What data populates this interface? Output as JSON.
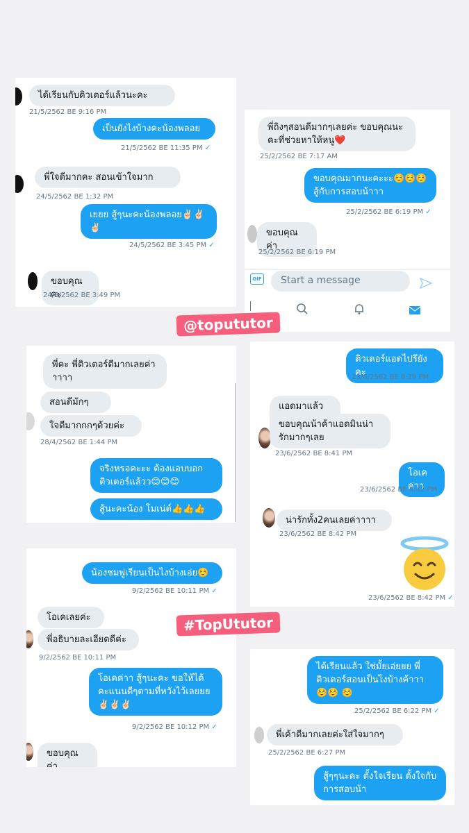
{
  "watermarks": {
    "handle": "@topututor",
    "hashtag": "#TopUtutor"
  },
  "chat_a": {
    "m1": "ได้เรียนกับติวเตอร์แล้วนะคะ",
    "t1": "21/5/2562 BE 9:16 PM",
    "m2": "เป็นยังไงบ้างคะน้องพลอย",
    "t2": "21/5/2562 BE 11:35 PM",
    "m3": "พี่ใจดีมากคะ สอนเข้าใจมาก",
    "t3": "24/5/2562 BE 1:32 PM",
    "m4": "เยยย สู้ๆนะคะน้องพลอย✌🏻✌🏻 ✌🏻",
    "t4": "24/5/2562 BE 3:45 PM",
    "m5": "ขอบคุณคะ",
    "t5": "24/5/2562 BE 3:49 PM"
  },
  "chat_b": {
    "m1": "พี่ถิงๆสอนดีมากๆเลยค่ะ ขอบคุณนะคะที่ช่วยหาให้หนู❤️",
    "t1": "25/2/2562 BE 7:17 AM",
    "m2": "ขอบคุณมากนะคะะะ☺️☺️☺️ สู้กับการสอบน้าาา",
    "t2": "25/2/2562 BE 6:19 PM",
    "m3": "ขอบคุณค่า",
    "t3": "25/2/2562 BE 6:19 PM",
    "composer_placeholder": "Start a message",
    "gif_label": "GIF"
  },
  "chat_c": {
    "m1": "พี่คะ พี่ติวเตอร์ดีมากเลยค่า าาาา",
    "m2": "สอนดีมักๆ",
    "m3": "ใจดีมากกกๆด้วยค่ะ",
    "t3": "28/4/2562 BE 1:44 PM",
    "m4": "จริงหรอคะะะ ต้องแอบบอกติวเตอร์แล้วว😊😊😊",
    "m5": "สู้นะคะน้อง โมเน่ต์👍👍👍"
  },
  "chat_d": {
    "m1": "ติวเตอร์แอดไปรึยังคะ",
    "t1": "23/6/2562 BE 8:39 PM",
    "m2": "แอดมาแล้วค้าาา",
    "m3": "ขอบคุณน้าค้าแอดมินน่ารักมากๆเลย",
    "t3": "23/6/2562 BE 8:41 PM",
    "m4": "โอเคค่าา",
    "t4": "23/6/2562 BE 8:42 PM",
    "m5": "น่ารักทั้ง2คนเลยค่าาาา",
    "t5": "23/6/2562 BE 8:42 PM",
    "t6": "23/6/2562 BE 8:42 PM"
  },
  "chat_e": {
    "m1": "น้องชมพู่เรียนเป็นไงบ้างเอ่ย☺️",
    "t1": "9/2/2562 BE 10:11 PM",
    "m2": "โอเคเลยค่ะ",
    "m3": "พี่อธิบายละเอียดดีค่ะ",
    "t3": "9/2/2562 BE 10:11 PM",
    "m4": "โอเคค่าา สู้ๆนะคะ ขอให้ได้คะแนนดีๆตามที่หวังไว้เลยยย ✌🏻✌🏻✌🏻",
    "t4": "9/2/2562 BE 10:12 PM",
    "m5": "ขอบคุณค่า"
  },
  "chat_f": {
    "m1": "ได้เรียนแล้ว ใช่มั้ยเอ่ยยย พี่ติวเตอร์สอนเป็นไงบ้างค้าาา☺️☺️ ☺️",
    "t1": "25/2/2562 BE 6:22 PM",
    "m2": "พี่เค้าดีมากเลยค่ะใส่ใจมากๆ",
    "t2": "25/2/2562 BE 6:27 PM",
    "m3": "สู้ๆๆนะคะ ตั้งใจเรียน ตั้งใจกับการสอบน้า"
  }
}
